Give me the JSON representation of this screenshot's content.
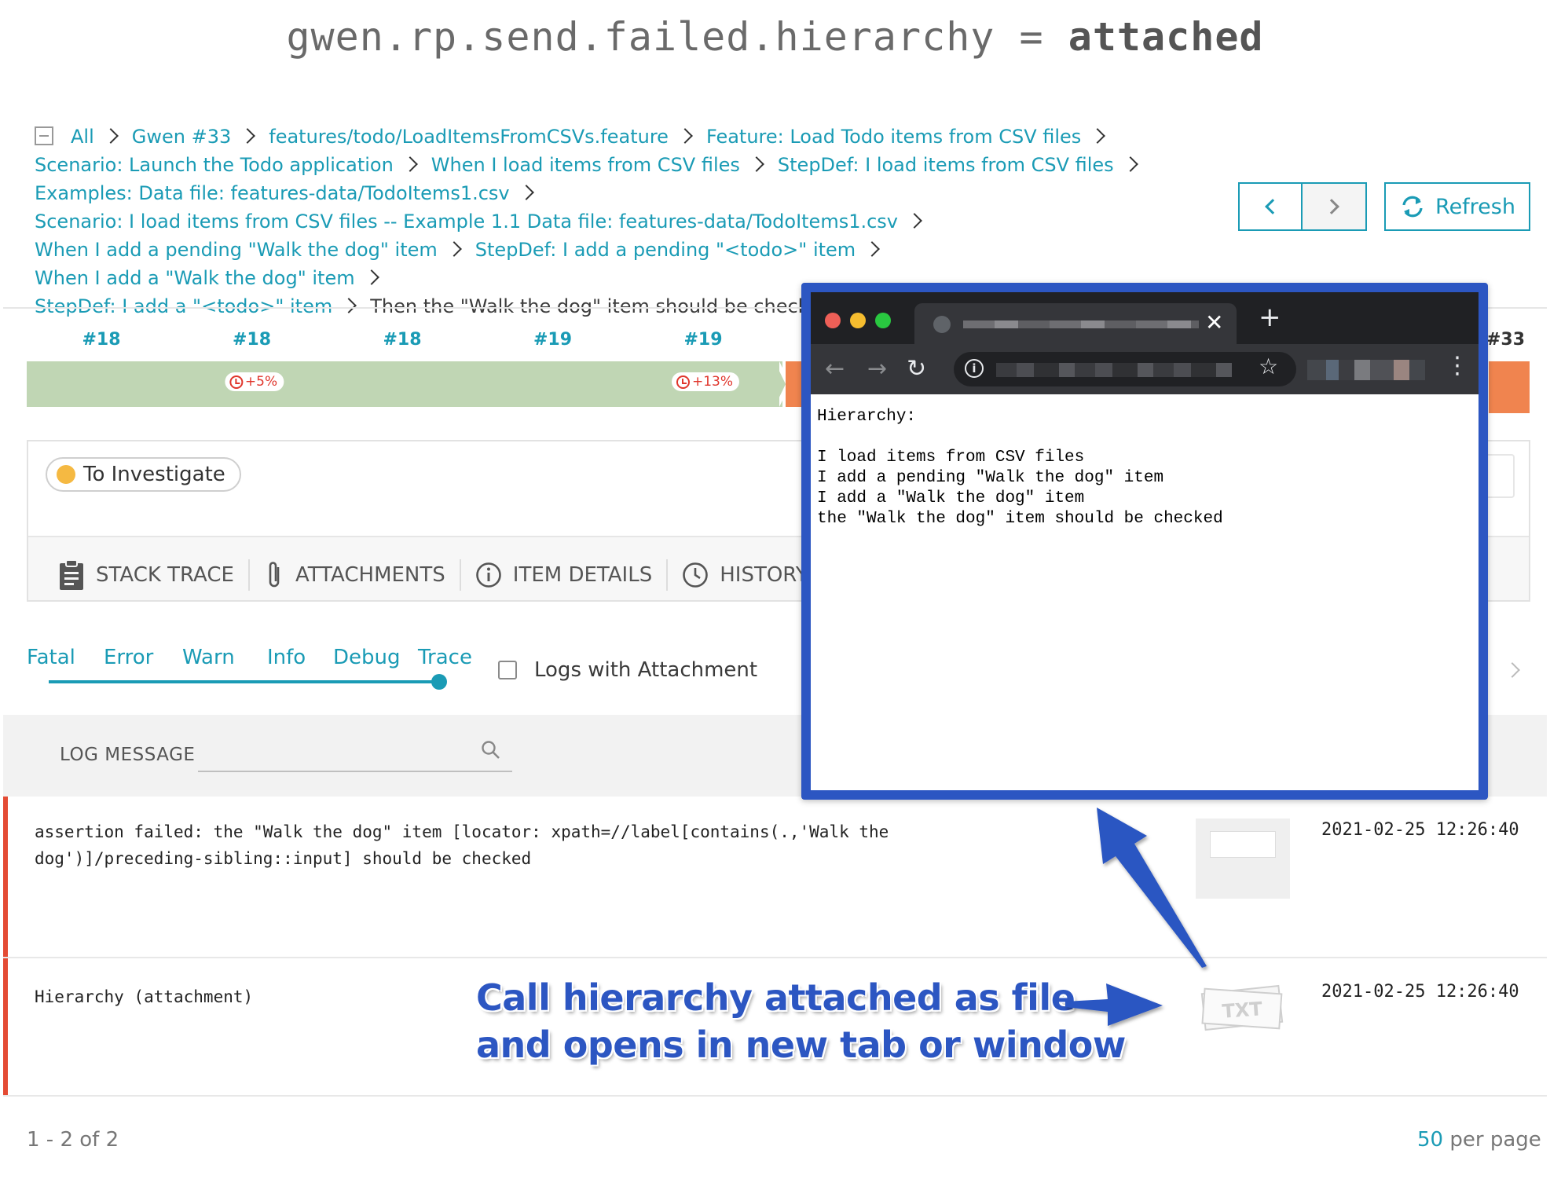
{
  "title": {
    "prefix": "gwen.rp.send.failed.hierarchy = ",
    "value": "attached"
  },
  "breadcrumbs": [
    "All",
    "Gwen #33",
    "features/todo/LoadItemsFromCSVs.feature",
    "Feature: Load Todo items from CSV files",
    "Scenario: Launch the Todo application",
    "When I load items from CSV files",
    "StepDef: I load items from CSV files",
    "Examples: Data file: features-data/TodoItems1.csv",
    "Scenario: I load items from CSV files -- Example 1.1 Data file: features-data/TodoItems1.csv",
    "When I add a pending \"Walk the dog\" item",
    "StepDef: I add a pending \"<todo>\" item",
    "When I add a \"Walk the dog\" item",
    "StepDef: I add a \"<todo>\" item",
    "Then the \"Walk the dog\" item should be checked"
  ],
  "toolbar": {
    "refresh_label": "Refresh"
  },
  "history": [
    {
      "label": "#18",
      "badge": ""
    },
    {
      "label": "#18",
      "badge": "+5%"
    },
    {
      "label": "#18",
      "badge": ""
    },
    {
      "label": "#19",
      "badge": ""
    },
    {
      "label": "#19",
      "badge": "+13%"
    }
  ],
  "history_last": "#33",
  "defect": {
    "status": "To Investigate",
    "color": "#f5b942"
  },
  "tabs": [
    "STACK TRACE",
    "ATTACHMENTS",
    "ITEM DETAILS",
    "HISTORY"
  ],
  "log_levels": [
    "Fatal",
    "Error",
    "Warn",
    "Info",
    "Debug",
    "Trace"
  ],
  "selected_level": "Trace",
  "logs_with_attachment_label": "Logs with Attachment",
  "log_table": {
    "header": "LOG MESSAGE"
  },
  "logs": [
    {
      "message": "assertion failed: the \"Walk the dog\" item [locator: xpath=//label[contains(.,'Walk the\ndog')]/preceding-sibling::input] should be checked",
      "time": "2021-02-25 12:26:40"
    },
    {
      "message": "Hierarchy (attachment)",
      "time": "2021-02-25 12:26:40",
      "attachment": "TXT"
    }
  ],
  "footer": {
    "range": "1 - 2 of 2",
    "per_page_count": "50",
    "per_page_label": " per page"
  },
  "browser": {
    "content": "Hierarchy:\n\nI load items from CSV files\nI add a pending \"Walk the dog\" item\nI add a \"Walk the dog\" item\nthe \"Walk the dog\" item should be checked"
  },
  "annotation": {
    "line1": "Call hierarchy attached as file",
    "line2": "and opens in new tab or window",
    "color": "#2c56c2"
  },
  "colors": {
    "accent": "#1a9bb5",
    "passed": "#c0d6b4",
    "failed": "#f0844f",
    "error_bar": "#e44b34"
  }
}
